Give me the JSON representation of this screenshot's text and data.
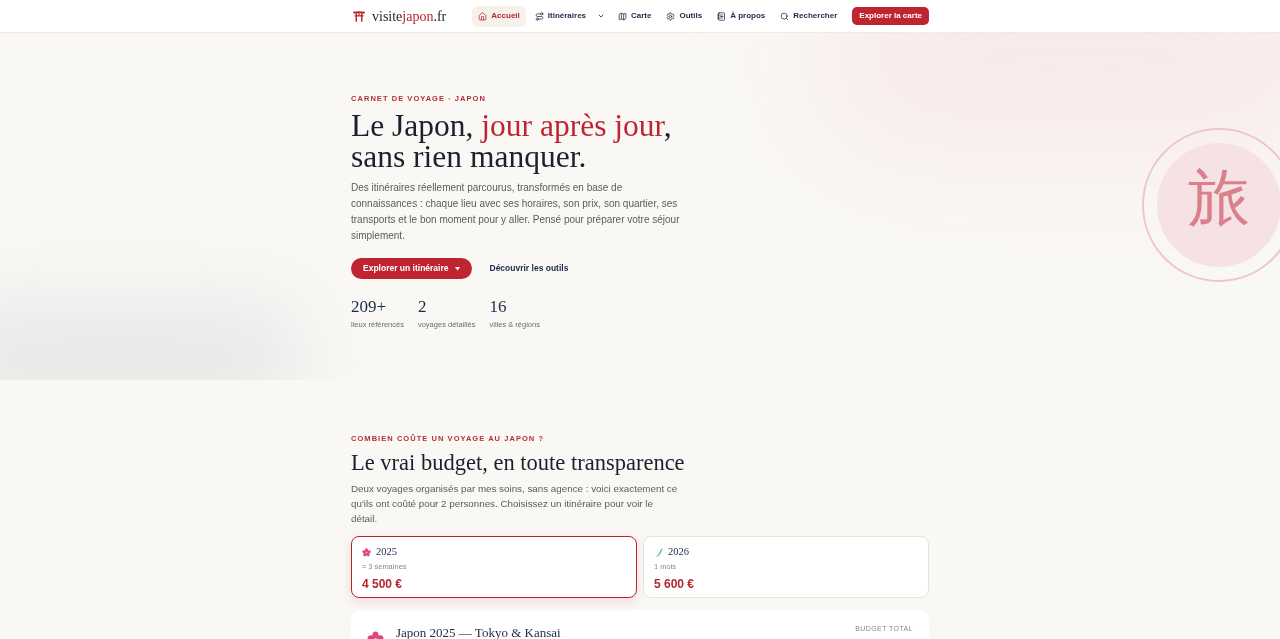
{
  "nav": {
    "logo": {
      "prefix": "visite",
      "accent": "japon",
      "suffix": ".fr"
    },
    "items": [
      {
        "label": "Accueil",
        "selected": true,
        "has_menu": false
      },
      {
        "label": "Itinéraires",
        "selected": false,
        "has_menu": true
      },
      {
        "label": "Carte",
        "selected": false,
        "has_menu": false
      },
      {
        "label": "Outils",
        "selected": false,
        "has_menu": false
      },
      {
        "label": "À propos",
        "selected": false,
        "has_menu": false
      },
      {
        "label": "Rechercher",
        "selected": false,
        "has_menu": false
      }
    ],
    "cta": "Explorer la carte"
  },
  "hero": {
    "eyebrow": "CARNET DE VOYAGE · JAPON",
    "title": {
      "lead": "Le Japon,",
      "accent": "jour après jour",
      "end": ",",
      "line2": "sans rien manquer."
    },
    "text": "Des itinéraires réellement parcourus, transformés en base de connaissances : chaque lieu avec ses horaires, son prix, son quartier, ses transports et le bon moment pour y aller. Pensé pour préparer votre séjour simplement.",
    "primary_button": "Explorer un itinéraire",
    "secondary_button": "Découvrir les outils",
    "stats": [
      {
        "value": "209+",
        "label": "lieux référencés"
      },
      {
        "value": "2",
        "label": "voyages détaillés"
      },
      {
        "value": "16",
        "label": "villes & régions"
      }
    ],
    "emblem": "旅"
  },
  "budget": {
    "eyebrow": "COMBIEN COÛTE UN VOYAGE AU JAPON ?",
    "title": "Le vrai budget, en toute transparence",
    "text": "Deux voyages organisés par mes soins, sans agence : voici exactement ce qu'ils ont coûté pour 2 personnes. Choisissez un itinéraire pour voir le détail.",
    "trips": [
      {
        "year": "2025",
        "duration": "≈ 3 semaines",
        "price": "4 500 €",
        "selected": true
      },
      {
        "year": "2026",
        "duration": "1 mois",
        "price": "5 600 €",
        "selected": false
      }
    ],
    "detail": {
      "title": "Japon 2025 — Tokyo & Kansai",
      "total_label": "BUDGET TOTAL"
    }
  }
}
